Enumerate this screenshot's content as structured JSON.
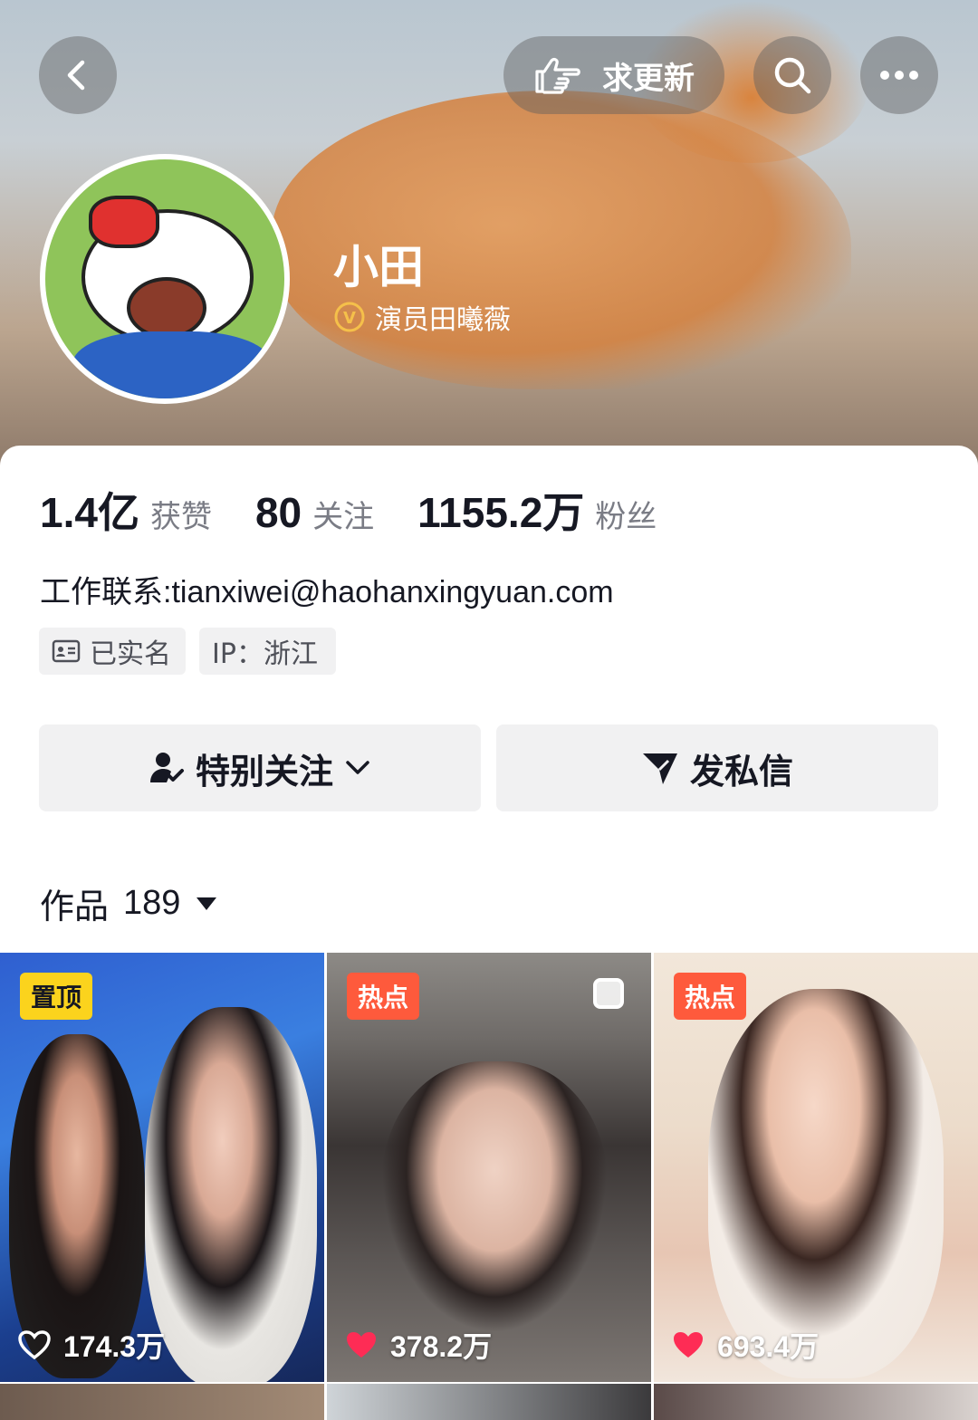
{
  "top_bar": {
    "update_label": "求更新"
  },
  "profile": {
    "name": "小田",
    "verified_text": "演员田曦薇",
    "verified_badge": "V"
  },
  "stats": [
    {
      "value": "1.4亿",
      "label": "获赞"
    },
    {
      "value": "80",
      "label": "关注"
    },
    {
      "value": "1155.2万",
      "label": "粉丝"
    }
  ],
  "bio": "工作联系:tianxiwei@haohanxingyuan.com",
  "tags": {
    "realname": "已实名",
    "ip": "IP：浙江"
  },
  "actions": {
    "follow": "特别关注",
    "message": "发私信"
  },
  "works": {
    "label": "作品",
    "count": "189"
  },
  "videos": [
    {
      "badge": "置顶",
      "likes": "174.3万"
    },
    {
      "badge": "热点",
      "likes": "378.2万"
    },
    {
      "badge": "热点",
      "likes": "693.4万"
    }
  ],
  "colors": {
    "accent_red": "#fe2c55",
    "pin_badge": "#fbd31d",
    "hot_badge": "#fe5a3c",
    "verify_gold": "#f5c04a"
  }
}
